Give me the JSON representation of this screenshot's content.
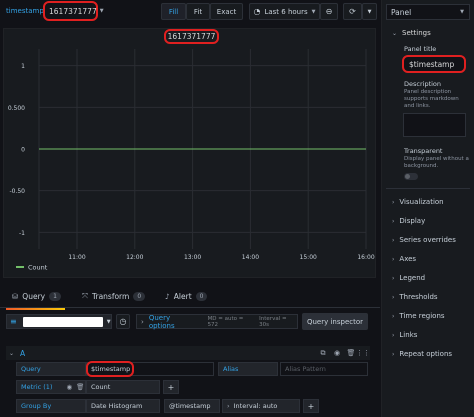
{
  "topbar": {
    "variable_label": "timestamp",
    "variable_value": "1617371777",
    "fill_label": "Fill",
    "fit_label": "Fit",
    "exact_label": "Exact",
    "time_range": "Last 6 hours",
    "panel_selector": "Panel"
  },
  "panel": {
    "title": "1617371777"
  },
  "chart_data": {
    "type": "line",
    "x": [
      "11:00",
      "12:00",
      "13:00",
      "14:00",
      "15:00",
      "16:00"
    ],
    "series": [
      {
        "name": "Count",
        "values": [
          0,
          0,
          0,
          0,
          0,
          0
        ],
        "color": "#73bf69"
      }
    ],
    "yticks": [
      "1",
      "0.500",
      "0",
      "-0.50",
      "-1"
    ],
    "yvalues": [
      1,
      0.5,
      0,
      -0.5,
      -1
    ],
    "ylim": [
      -1.2,
      1.2
    ],
    "grid": true,
    "legend": "bottom-left"
  },
  "tabs": [
    {
      "label": "Query",
      "count": "1"
    },
    {
      "label": "Transform",
      "count": "0"
    },
    {
      "label": "Alert",
      "count": "0"
    }
  ],
  "query_bar": {
    "query_options": "Query options",
    "meta": "MD = auto = 572",
    "interval": "Interval = 30s",
    "inspector": "Query inspector"
  },
  "query": {
    "ref": "A",
    "query_label": "Query",
    "query_value": "$timestamp",
    "alias_label": "Alias",
    "alias_placeholder": "Alias Pattern",
    "metric_label": "Metric (1)",
    "metric_value": "Count",
    "groupby_label": "Group By",
    "groupby_value": "Date Histogram",
    "groupby_field": "@timestamp",
    "interval_value": "Interval: auto"
  },
  "sidebar": {
    "settings_title": "Settings",
    "panel_title_label": "Panel title",
    "panel_title_value": "$timestamp",
    "description_label": "Description",
    "description_help": "Panel description supports markdown and links.",
    "transparent_label": "Transparent",
    "transparent_help": "Display panel without a background.",
    "sections": [
      "Visualization",
      "Display",
      "Series overrides",
      "Axes",
      "Legend",
      "Thresholds",
      "Time regions",
      "Links",
      "Repeat options"
    ]
  }
}
